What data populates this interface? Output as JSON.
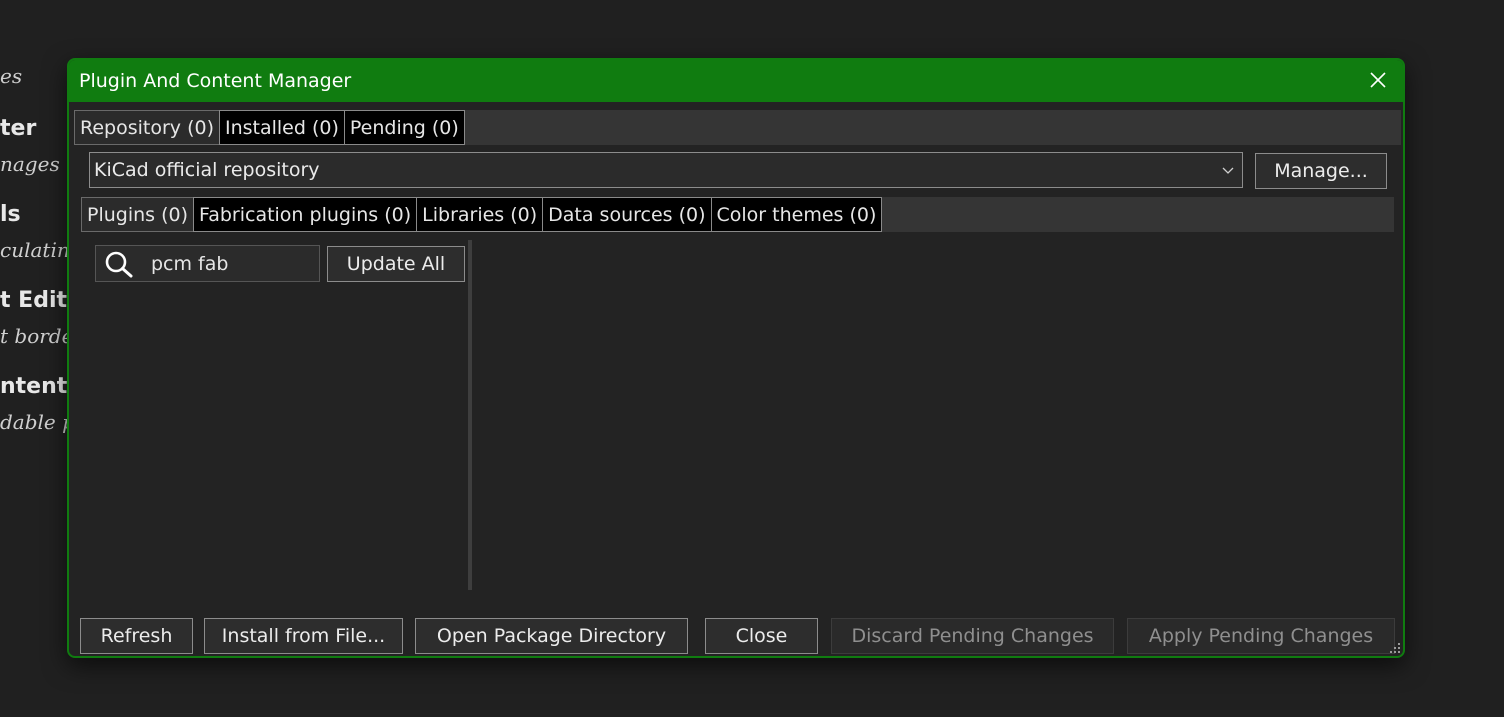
{
  "background": {
    "lines": [
      {
        "text": "es",
        "style": "sub"
      },
      {
        "text": "ter",
        "style": "heading"
      },
      {
        "text": "nages to",
        "style": "sub"
      },
      {
        "text": "ls",
        "style": "heading"
      },
      {
        "text": "culating",
        "style": "sub"
      },
      {
        "text": "t Edito",
        "style": "heading"
      },
      {
        "text": "t border",
        "style": "sub"
      },
      {
        "text": "ntent",
        "style": "heading"
      },
      {
        "text": "dable pa",
        "style": "sub"
      }
    ]
  },
  "dialog": {
    "title": "Plugin And Content Manager",
    "accent_color": "#107c10",
    "close_icon": "close-icon"
  },
  "outer_tabs": [
    {
      "label": "Repository (0)",
      "active": true
    },
    {
      "label": "Installed (0)",
      "active": false
    },
    {
      "label": "Pending (0)",
      "active": false
    }
  ],
  "repository": {
    "selected": "KiCad official repository",
    "manage_label": "Manage..."
  },
  "inner_tabs": [
    {
      "label": "Plugins (0)",
      "active": true
    },
    {
      "label": "Fabrication plugins (0)",
      "active": false
    },
    {
      "label": "Libraries (0)",
      "active": false
    },
    {
      "label": "Data sources (0)",
      "active": false
    },
    {
      "label": "Color themes (0)",
      "active": false
    }
  ],
  "search": {
    "value": "pcm fab",
    "icon": "search-icon"
  },
  "update_all_label": "Update All",
  "footer": {
    "refresh": "Refresh",
    "install_from_file": "Install from File...",
    "open_package_directory": "Open Package Directory",
    "close": "Close",
    "discard_pending": "Discard Pending Changes",
    "apply_pending": "Apply Pending Changes"
  }
}
